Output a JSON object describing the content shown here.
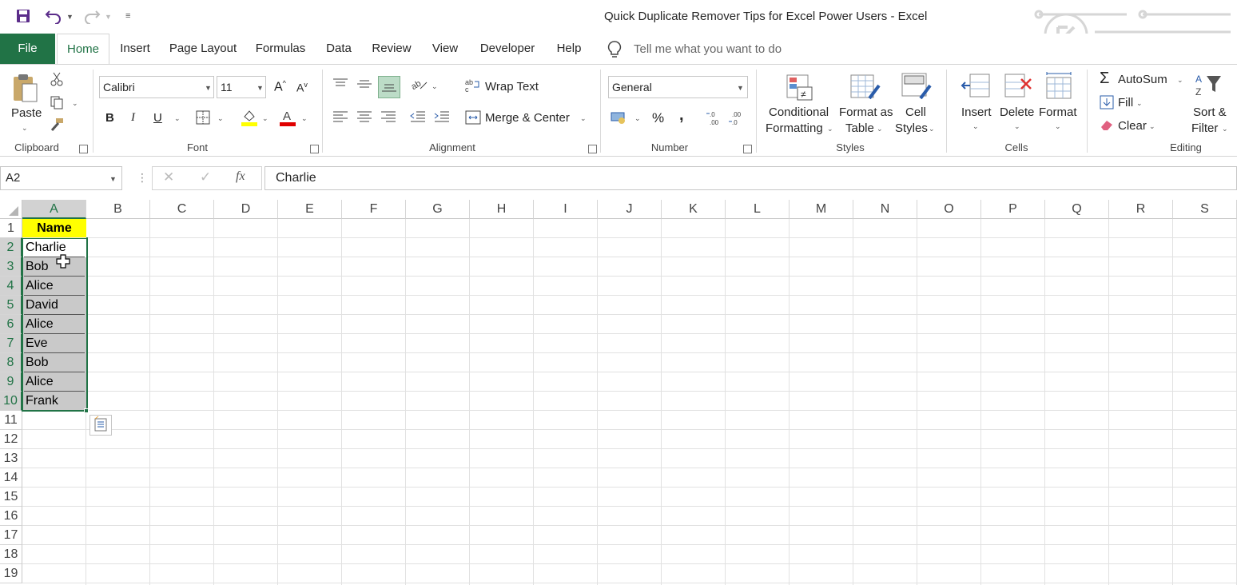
{
  "title_bar": {
    "title": "Quick Duplicate Remover Tips for Excel Power Users  -  Excel"
  },
  "tabs": [
    "File",
    "Home",
    "Insert",
    "Page Layout",
    "Formulas",
    "Data",
    "Review",
    "View",
    "Developer",
    "Help"
  ],
  "tell_me": {
    "placeholder": "Tell me what you want to do"
  },
  "ribbon": {
    "clipboard": {
      "paste": "Paste",
      "label": "Clipboard"
    },
    "font": {
      "name": "Calibri",
      "size": "11",
      "bold": "B",
      "italic": "I",
      "underline": "U",
      "label": "Font"
    },
    "alignment": {
      "wrap": "Wrap Text",
      "merge": "Merge & Center",
      "label": "Alignment"
    },
    "number": {
      "format": "General",
      "percent": "%",
      "comma": ",",
      "label": "Number"
    },
    "styles": {
      "conditional_1": "Conditional",
      "conditional_2": "Formatting",
      "format_table_1": "Format as",
      "format_table_2": "Table",
      "cell_styles_1": "Cell",
      "cell_styles_2": "Styles",
      "label": "Styles"
    },
    "cells": {
      "insert": "Insert",
      "delete": "Delete",
      "format": "Format",
      "label": "Cells"
    },
    "editing": {
      "autosum": "AutoSum",
      "fill": "Fill",
      "clear": "Clear",
      "sort_1": "Sort &",
      "sort_2": "Filter",
      "label": "Editing"
    }
  },
  "formula_bar": {
    "name_box": "A2",
    "fx": "fx",
    "value": "Charlie"
  },
  "columns": [
    "A",
    "B",
    "C",
    "D",
    "E",
    "F",
    "G",
    "H",
    "I",
    "J",
    "K",
    "L",
    "M",
    "N",
    "O",
    "P",
    "Q",
    "R",
    "S"
  ],
  "rows": [
    "1",
    "2",
    "3",
    "4",
    "5",
    "6",
    "7",
    "8",
    "9",
    "10",
    "11",
    "12",
    "13",
    "14",
    "15",
    "16",
    "17",
    "18",
    "19"
  ],
  "cells": {
    "header": "Name",
    "values": [
      "Charlie",
      "Bob",
      "Alice",
      "David",
      "Alice",
      "Eve",
      "Bob",
      "Alice",
      "Frank"
    ]
  },
  "colors": {
    "excel_green": "#217346",
    "header_yellow": "#ffff00",
    "selection_gray": "#c9c9c9"
  }
}
